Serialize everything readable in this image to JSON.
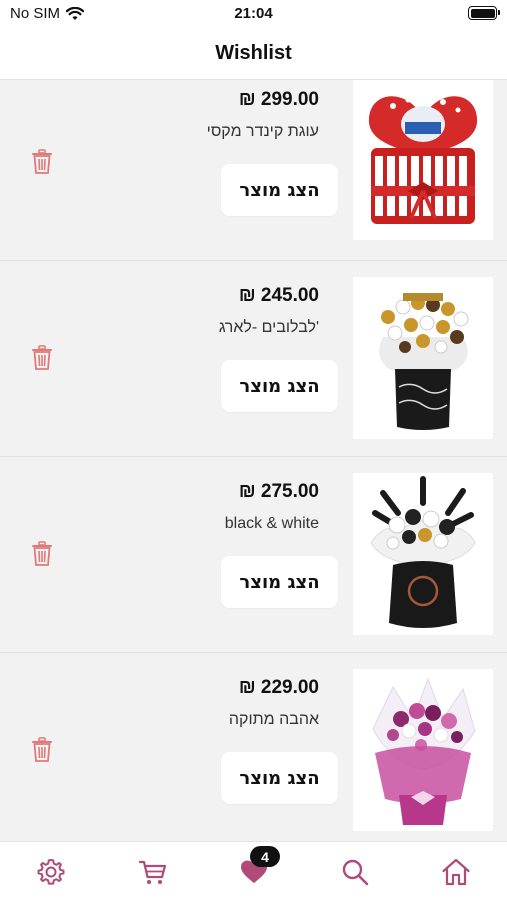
{
  "status_bar": {
    "carrier": "No SIM",
    "time": "21:04",
    "wifi_icon": "wifi-icon",
    "battery_icon": "battery-icon"
  },
  "header": {
    "title": "Wishlist"
  },
  "wishlist": {
    "items": [
      {
        "price": "₪ 299.00",
        "name": "עוגת קינדר מקסי",
        "button_label": "הצג מוצר",
        "image": "kinder-cake-heart-image"
      },
      {
        "price": "₪ 245.00",
        "name": "לבלובים -לארג'",
        "button_label": "הצג מוצר",
        "image": "chocolate-bouquet-gold-image"
      },
      {
        "price": "₪ 275.00",
        "name": "black & white",
        "button_label": "הצג מוצר",
        "image": "black-white-bouquet-image"
      },
      {
        "price": "₪ 229.00",
        "name": "אהבה מתוקה",
        "button_label": "הצג מוצר",
        "image": "pink-bouquet-image"
      }
    ]
  },
  "tab_bar": {
    "tabs": [
      {
        "icon": "gear-icon"
      },
      {
        "icon": "cart-icon"
      },
      {
        "icon": "heart-icon",
        "badge": "4",
        "active": true
      },
      {
        "icon": "search-icon"
      },
      {
        "icon": "home-icon"
      }
    ]
  },
  "colors": {
    "accent": "#b04a78",
    "trash": "#e07a7a",
    "list_bg": "#f2f2f2"
  }
}
